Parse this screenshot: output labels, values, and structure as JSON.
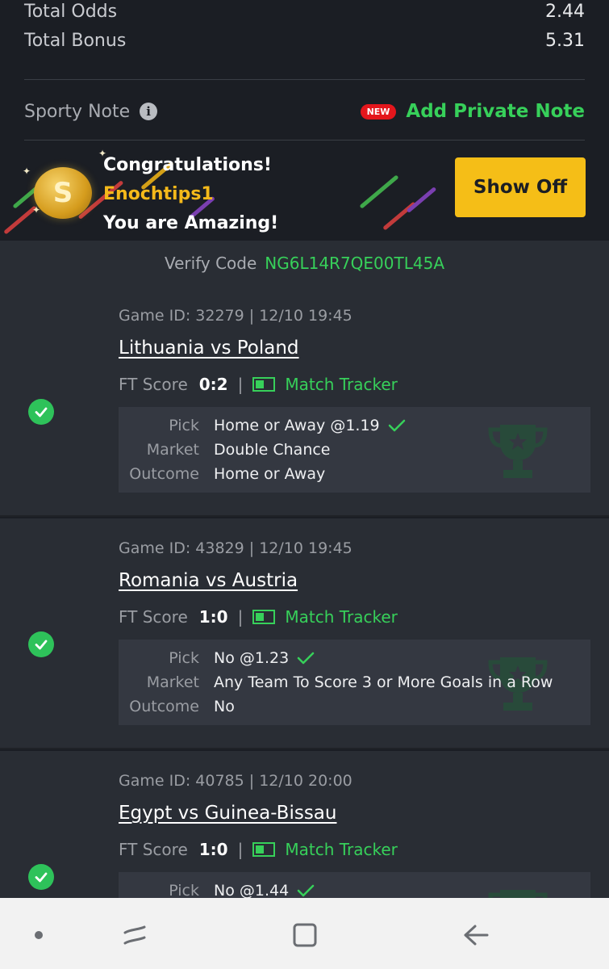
{
  "summary": {
    "total_odds_label": "Total Odds",
    "total_odds_value": "2.44",
    "total_bonus_label": "Total Bonus",
    "total_bonus_value": "5.31"
  },
  "note": {
    "label": "Sporty Note",
    "new_badge": "NEW",
    "add_private_note": "Add Private Note"
  },
  "congrats": {
    "line1": "Congratulations!",
    "username": "Enochtips1",
    "line3": "You are Amazing!",
    "show_off_button": "Show Off",
    "coin_symbol": "S"
  },
  "verify": {
    "label": "Verify Code",
    "code": "NG6L14R7QE00TL45A"
  },
  "labels": {
    "ft_score": "FT Score",
    "match_tracker": "Match Tracker",
    "pick": "Pick",
    "market": "Market",
    "outcome": "Outcome",
    "separator": "|"
  },
  "games": [
    {
      "meta": "Game ID: 32279 | 12/10 19:45",
      "title": "Lithuania vs Poland",
      "score": "0:2",
      "pick": "Home or Away @1.19",
      "market": "Double Chance",
      "outcome": "Home or Away",
      "status": "won"
    },
    {
      "meta": "Game ID: 43829 | 12/10 19:45",
      "title": "Romania vs Austria",
      "score": "1:0",
      "pick": "No @1.23",
      "market": "Any Team To Score 3 or More Goals in a Row",
      "outcome": "No",
      "status": "won"
    },
    {
      "meta": "Game ID: 40785 | 12/10 20:00",
      "title": "Egypt vs Guinea-Bissau",
      "score": "1:0",
      "pick": "No @1.44",
      "market": "",
      "outcome": "",
      "status": "won"
    }
  ],
  "colors": {
    "accent_green": "#37d05a",
    "show_off_yellow": "#f5be17",
    "new_badge_red": "#e4161c",
    "background": "#1b1e24"
  },
  "icons": {
    "info": "info-icon",
    "check": "check-circle-icon",
    "tracker": "match-tracker-icon",
    "trophy": "trophy-icon",
    "nav": [
      "home-dot-icon",
      "recent-apps-icon",
      "home-square-icon",
      "back-arrow-icon"
    ]
  }
}
